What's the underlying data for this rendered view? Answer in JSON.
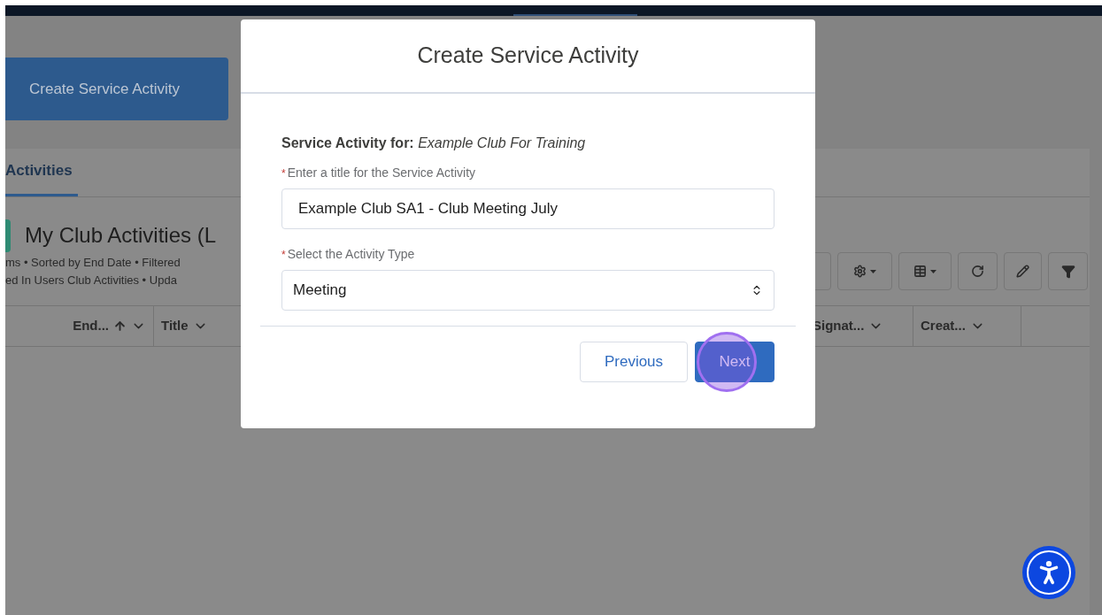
{
  "page": {
    "create_button": "Create Service Activity",
    "tab": {
      "label": "Activities",
      "selected": true
    },
    "list": {
      "title": "My Club Activities (L",
      "meta": [
        "ms • Sorted by End Date • Filtered",
        "ed In Users Club Activities • Upda"
      ]
    },
    "toolbar": [
      {
        "kind": "blank"
      },
      {
        "kind": "settings"
      },
      {
        "kind": "table"
      },
      {
        "kind": "refresh"
      },
      {
        "kind": "edit"
      },
      {
        "kind": "filter"
      }
    ],
    "columns": [
      {
        "label": "End...",
        "sorted": true
      },
      {
        "label": "Title",
        "sorted": false
      },
      {
        "label": "Signat...",
        "sorted": false
      },
      {
        "label": "Creat...",
        "sorted": false
      }
    ]
  },
  "modal": {
    "title": "Create Service Activity",
    "context": "**Service Activity for:** *Example Club For Training*",
    "fields": [
      {
        "kind": "text",
        "marker": "*",
        "label": "Enter a title for the Service Activity",
        "value": "Example Club SA1 - Club Meeting July"
      },
      {
        "kind": "select",
        "marker": "*",
        "label": "Select the Activity Type",
        "value": "Meeting"
      }
    ],
    "buttons": [
      {
        "label": "Previous",
        "kind": "neutral",
        "highlighted": false
      },
      {
        "label": "Next",
        "kind": "brand",
        "highlighted": true
      }
    ]
  }
}
